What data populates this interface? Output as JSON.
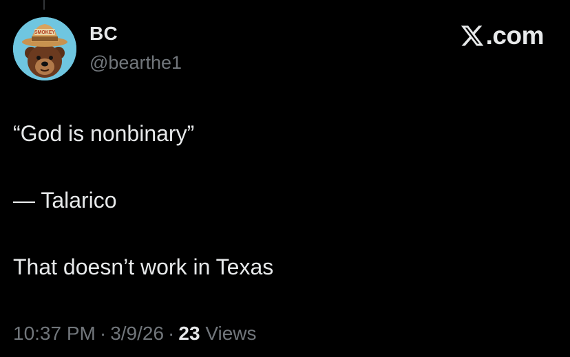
{
  "author": {
    "display_name": "BC",
    "handle": "@bearthe1",
    "avatar": {
      "icon": "smokey-bear-avatar-icon",
      "hat_text": "SMOKEY",
      "background_color": "#6fc6e0"
    }
  },
  "watermark": {
    "logo_icon": "x-logo-icon",
    "text": ".com"
  },
  "tweet": {
    "lines": [
      "“God is nonbinary”",
      "— Talarico",
      "That doesn’t work in Texas"
    ]
  },
  "meta": {
    "time": "10:37 PM",
    "separator": "·",
    "date": "3/9/26",
    "views_count": "23",
    "views_label": "Views"
  },
  "colors": {
    "background": "#000000",
    "primary_text": "#e7e9ea",
    "secondary_text": "#71767b"
  }
}
